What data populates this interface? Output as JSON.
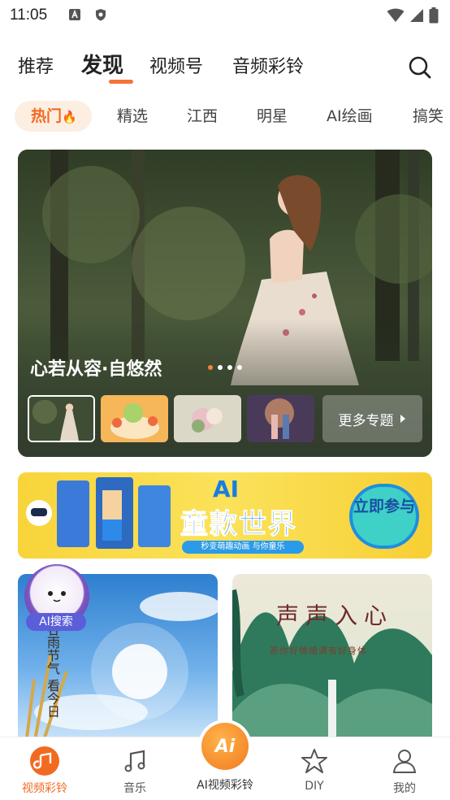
{
  "status_bar": {
    "time": "11:05"
  },
  "top_nav": {
    "tabs": [
      "推荐",
      "发现",
      "视频号",
      "音频彩铃"
    ],
    "active_tab": "发现"
  },
  "categories": {
    "items": [
      "热门",
      "精选",
      "江西",
      "明星",
      "AI绘画",
      "搞笑"
    ],
    "active": "热门"
  },
  "banner": {
    "caption": "心若从容·自悠然",
    "more_label": "更多专题"
  },
  "ad": {
    "ai_text": "AI",
    "title": "童款世界",
    "subtitle": "秒变萌趣动画 与你童乐",
    "cta": "立即参与"
  },
  "feed": {
    "card1_text": "谷雨节气 看今日",
    "card2_title": "声声入心",
    "card2_subtitle": "愿你好情绪满有好身体"
  },
  "ai_search_label": "AI搜索",
  "tab_bar": {
    "items": [
      "视频彩铃",
      "音乐",
      "AI视频彩铃",
      "DIY",
      "我的"
    ],
    "active": "视频彩铃",
    "center_glyph": "Ai"
  },
  "colors": {
    "accent": "#f26a22",
    "chip_bg": "#fdeee2"
  }
}
